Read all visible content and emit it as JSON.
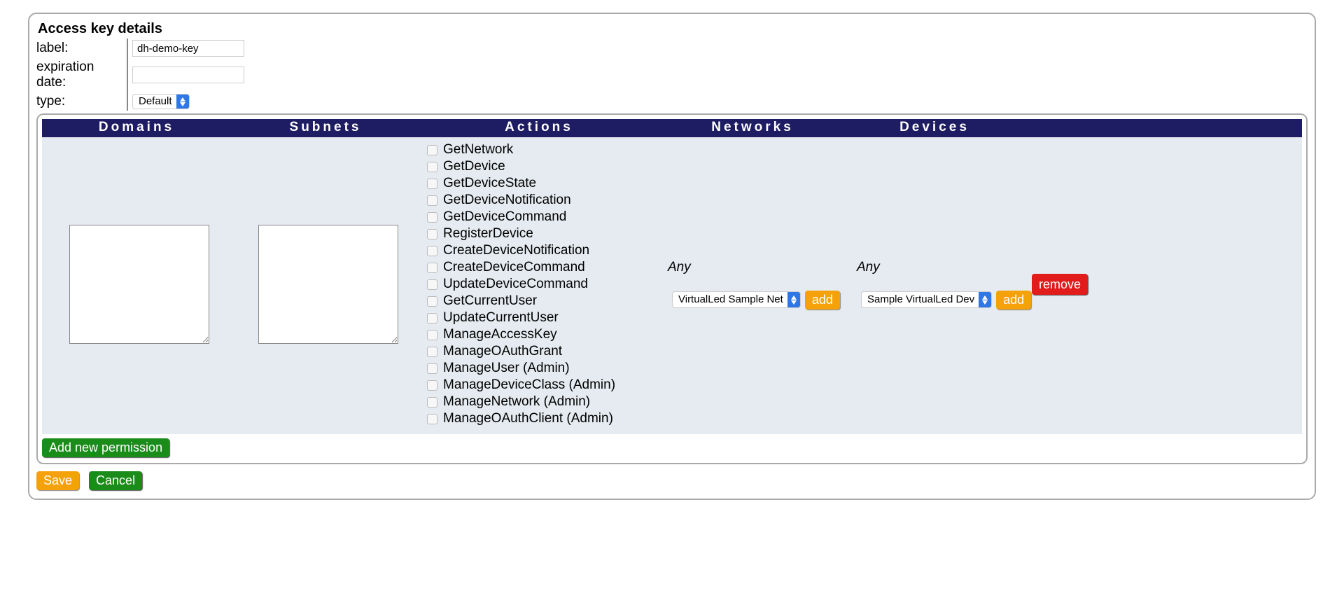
{
  "title": "Access key details",
  "form": {
    "label_caption": "label:",
    "label_value": "dh-demo-key",
    "expiration_caption": "expiration date:",
    "expiration_value": "",
    "type_caption": "type:",
    "type_value": "Default"
  },
  "headers": {
    "domains": "Domains",
    "subnets": "Subnets",
    "actions": "Actions",
    "networks": "Networks",
    "devices": "Devices"
  },
  "permission": {
    "domains_text": "",
    "subnets_text": "",
    "actions": [
      "GetNetwork",
      "GetDevice",
      "GetDeviceState",
      "GetDeviceNotification",
      "GetDeviceCommand",
      "RegisterDevice",
      "CreateDeviceNotification",
      "CreateDeviceCommand",
      "UpdateDeviceCommand",
      "GetCurrentUser",
      "UpdateCurrentUser",
      "ManageAccessKey",
      "ManageOAuthGrant",
      "ManageUser (Admin)",
      "ManageDeviceClass (Admin)",
      "ManageNetwork (Admin)",
      "ManageOAuthClient (Admin)"
    ],
    "networks_any": "Any",
    "networks_select": "VirtualLed Sample Net",
    "devices_any": "Any",
    "devices_select": "Sample VirtualLed Dev"
  },
  "buttons": {
    "add": "add",
    "remove": "remove",
    "add_permission": "Add new permission",
    "save": "Save",
    "cancel": "Cancel"
  }
}
